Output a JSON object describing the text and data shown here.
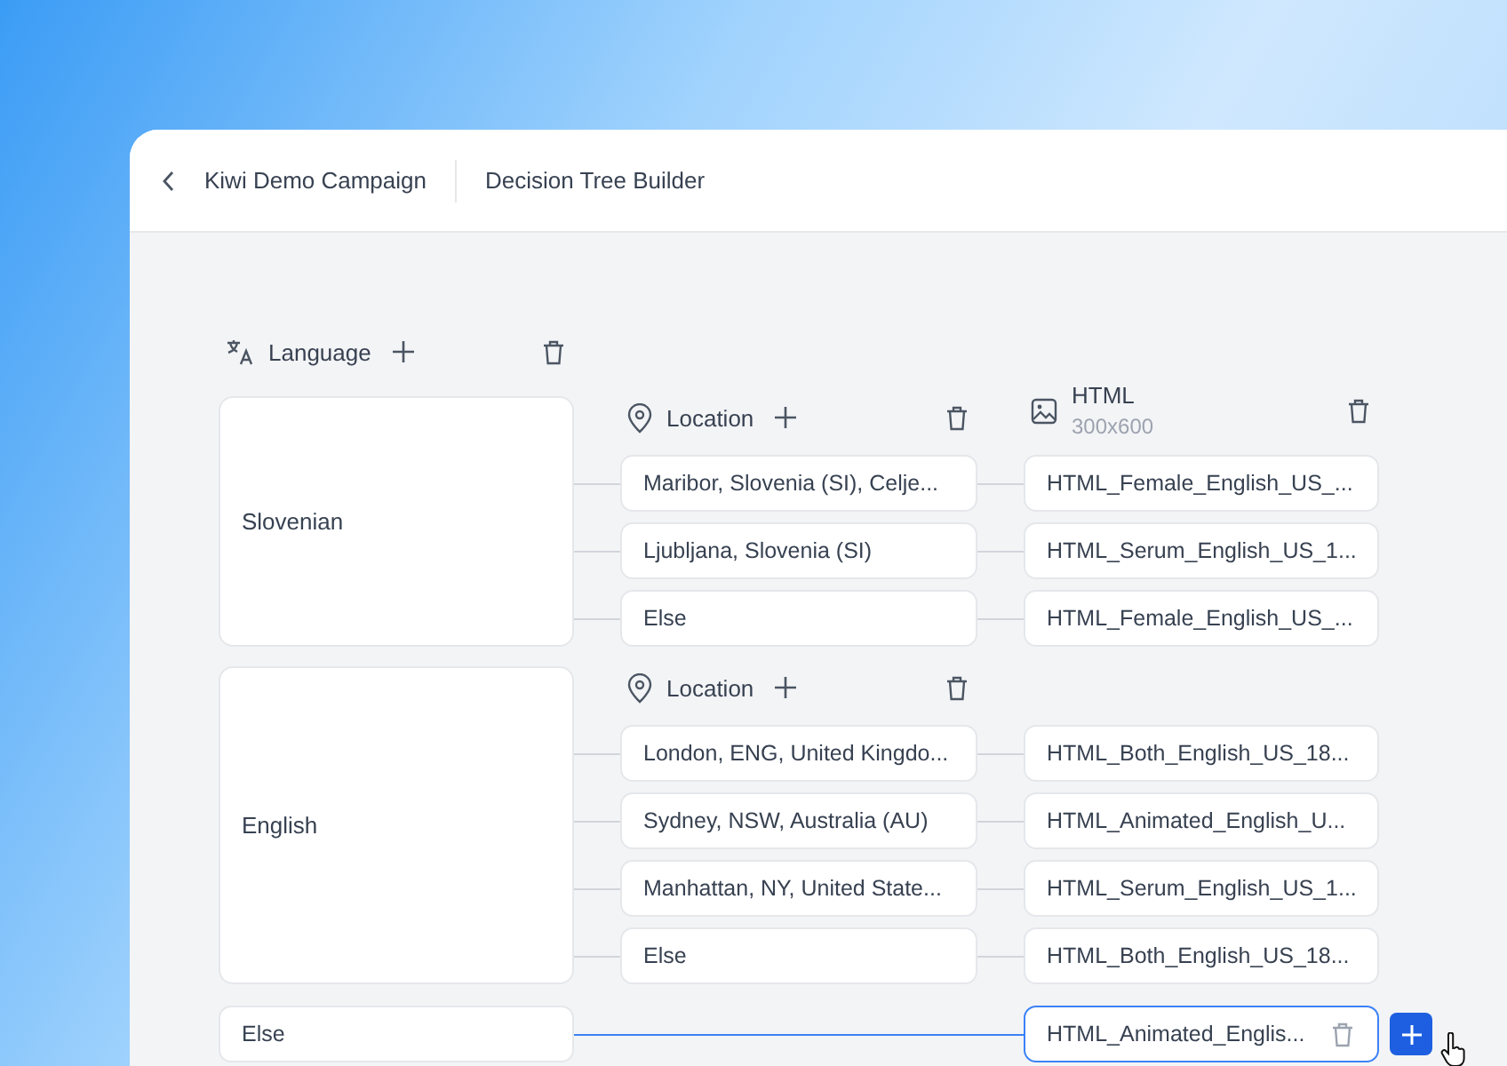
{
  "header": {
    "breadcrumb": "Kiwi Demo Campaign",
    "title": "Decision Tree Builder"
  },
  "language_column": {
    "label": "Language"
  },
  "groups": [
    {
      "language": "Slovenian",
      "location_label": "Location",
      "html_header": {
        "label": "HTML",
        "size": "300x600"
      },
      "rows": [
        {
          "location": "Maribor, Slovenia (SI), Celje...",
          "html": "HTML_Female_English_US_..."
        },
        {
          "location": "Ljubljana, Slovenia (SI)",
          "html": "HTML_Serum_English_US_1..."
        },
        {
          "location": "Else",
          "html": "HTML_Female_English_US_..."
        }
      ]
    },
    {
      "language": "English",
      "location_label": "Location",
      "rows": [
        {
          "location": "London, ENG, United Kingdo...",
          "html": "HTML_Both_English_US_18..."
        },
        {
          "location": "Sydney, NSW, Australia (AU)",
          "html": "HTML_Animated_English_U..."
        },
        {
          "location": "Manhattan, NY, United State...",
          "html": "HTML_Serum_English_US_1..."
        },
        {
          "location": "Else",
          "html": "HTML_Both_English_US_18..."
        }
      ]
    }
  ],
  "else_row": {
    "language": "Else",
    "html": "HTML_Animated_Englis...",
    "selected": true
  }
}
